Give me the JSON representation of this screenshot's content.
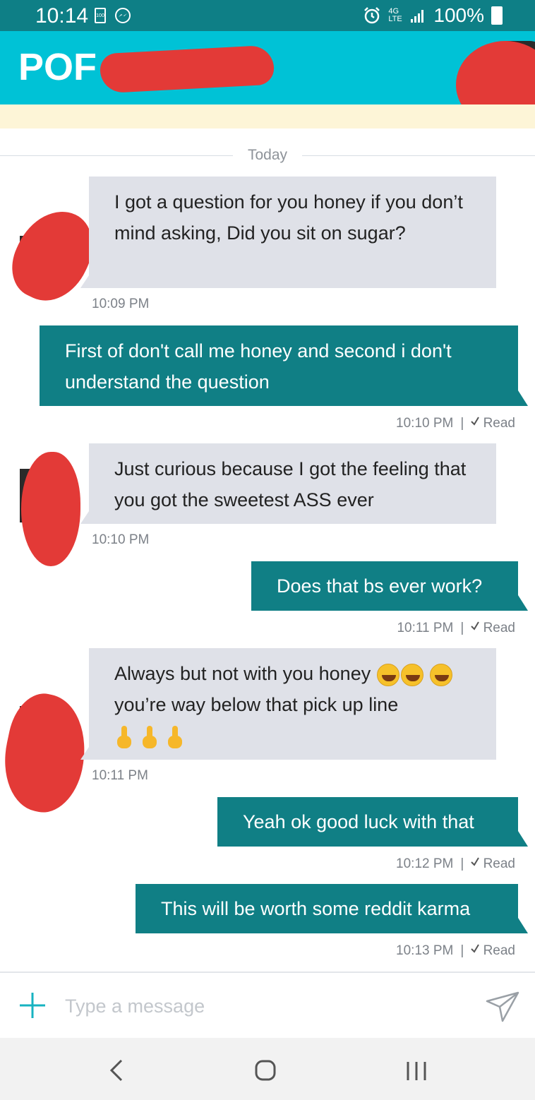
{
  "status_bar": {
    "time": "10:14",
    "battery_mini_text": "100",
    "network": "4G LTE",
    "battery_percent": "100%"
  },
  "app_bar": {
    "logo": "POF"
  },
  "date_divider": "Today",
  "messages": [
    {
      "direction": "in",
      "text": "I got a question for you honey if you don’t mind asking, Did you sit on sugar?",
      "time": "10:09 PM"
    },
    {
      "direction": "out",
      "text": "First of don't call me honey and second i don't understand the question",
      "time": "10:10 PM",
      "status": "Read"
    },
    {
      "direction": "in",
      "text": "Just curious because I got the feeling that you got the sweetest ASS ever",
      "time": "10:10 PM"
    },
    {
      "direction": "out",
      "text": "Does that bs ever work?",
      "time": "10:11 PM",
      "status": "Read"
    },
    {
      "direction": "in",
      "text_before_emoji": "Always but not with you honey",
      "text_after_emoji": "you’re way below that pick up line",
      "emoji": [
        "face-with-tears-of-joy",
        "face-with-tears-of-joy",
        "face-with-tears-of-joy",
        "middle-finger",
        "middle-finger",
        "middle-finger"
      ],
      "time": "10:11 PM"
    },
    {
      "direction": "out",
      "text": "Yeah ok good luck with that",
      "time": "10:12 PM",
      "status": "Read"
    },
    {
      "direction": "out",
      "text": "This will be worth some reddit karma",
      "time": "10:13 PM",
      "status": "Read"
    }
  ],
  "composer": {
    "placeholder": "Type a message"
  },
  "colors": {
    "status_bar": "#0e7f86",
    "app_bar": "#00c2d6",
    "outgoing_bubble": "#107f85",
    "incoming_bubble": "#dfe1e8",
    "redaction": "#e33a37"
  },
  "icons": [
    "alarm-icon",
    "signal-icon",
    "battery-icon",
    "messenger-icon",
    "plus-icon",
    "send-icon",
    "back-icon",
    "home-icon",
    "recents-icon",
    "check-icon"
  ]
}
